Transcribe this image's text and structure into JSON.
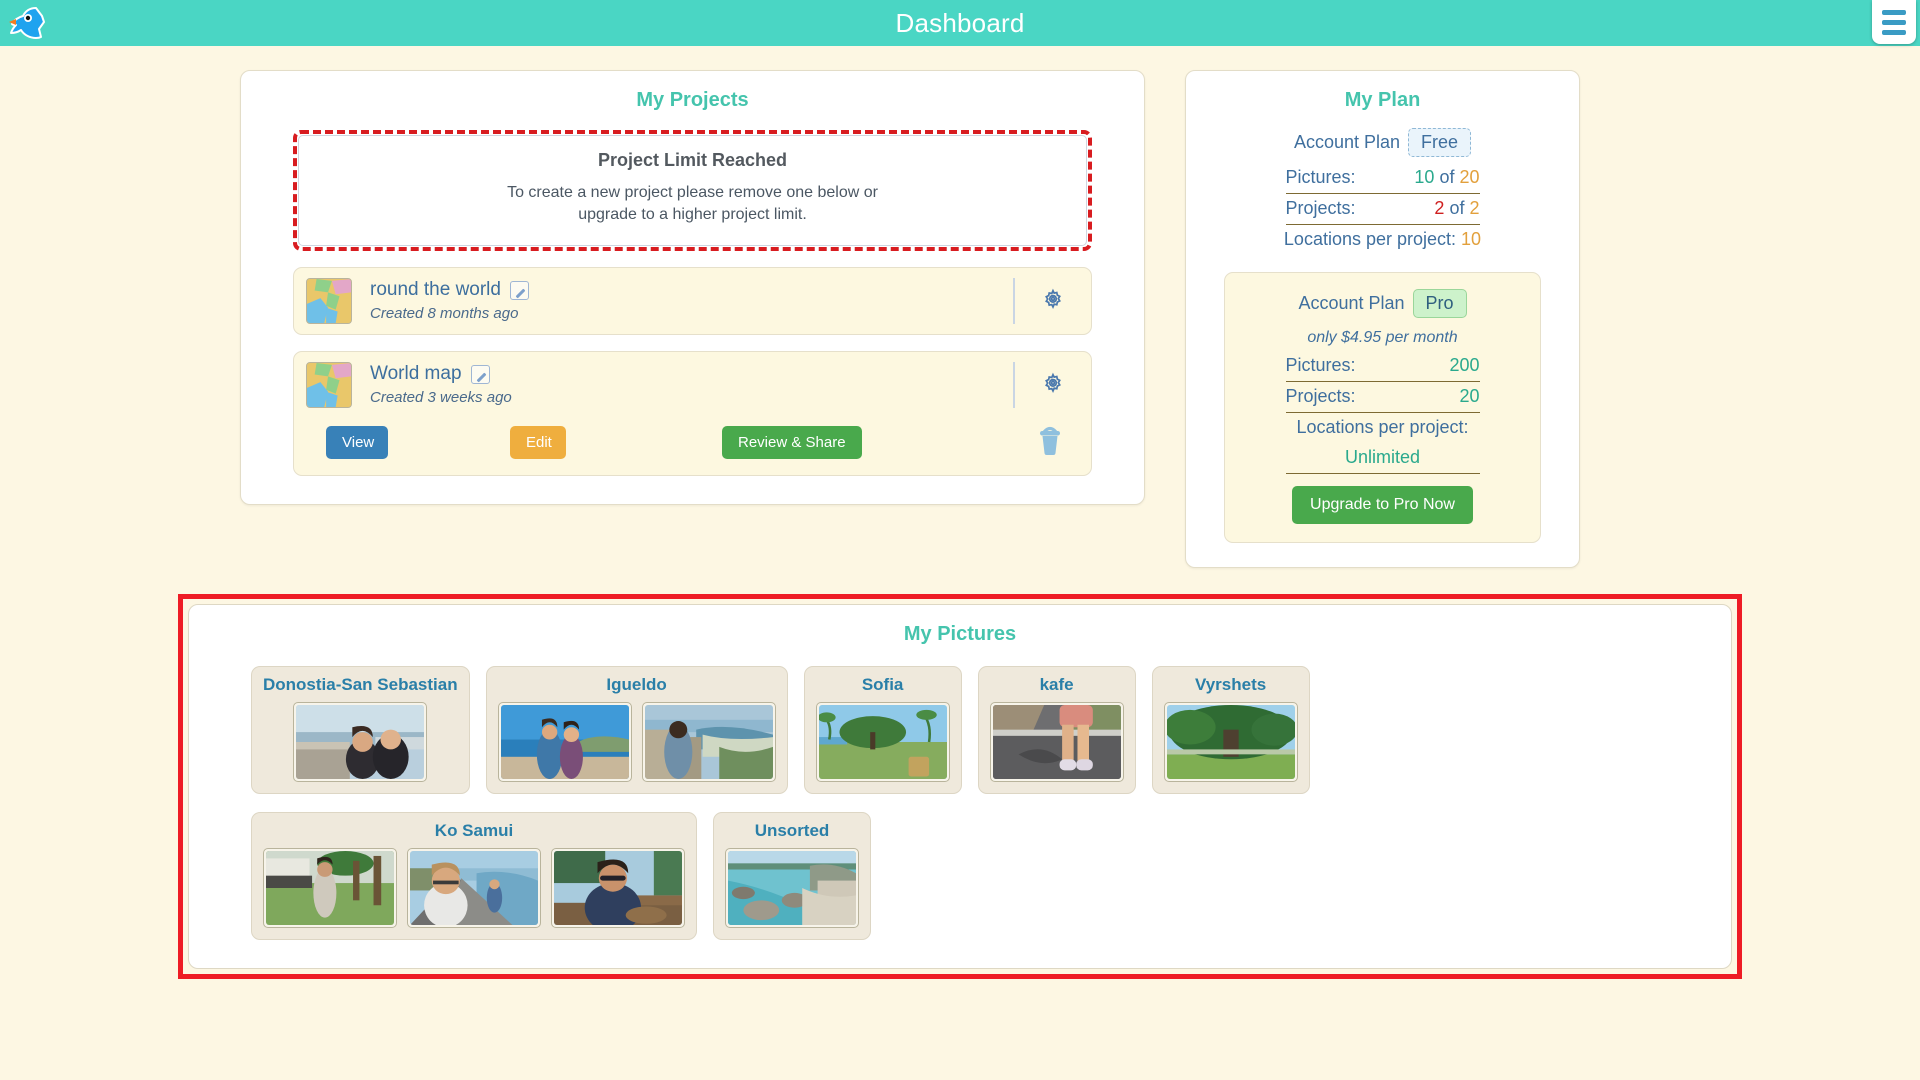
{
  "header": {
    "title": "Dashboard",
    "logo_icon": "bird-logo-icon",
    "menu_icon": "hamburger-menu-icon"
  },
  "projects_panel": {
    "title": "My Projects",
    "limit_alert": {
      "title": "Project Limit Reached",
      "line1": "To create a new project please remove one below or",
      "line2": "upgrade to a higher project limit."
    },
    "items": [
      {
        "name": "round the world",
        "created": "Created 8 months ago",
        "thumb_icon": "world-map-thumbnail",
        "edit_icon": "pencil-edit-icon",
        "gear_icon": "gear-settings-icon",
        "expanded": false
      },
      {
        "name": "World map",
        "created": "Created 3 weeks ago",
        "thumb_icon": "world-map-thumbnail",
        "edit_icon": "pencil-edit-icon",
        "gear_icon": "gear-settings-icon",
        "expanded": true
      }
    ],
    "actions": {
      "view": "View",
      "edit": "Edit",
      "share": "Review & Share",
      "delete_icon": "trash-delete-icon"
    }
  },
  "plan_panel": {
    "title": "My Plan",
    "free": {
      "account_plan_label": "Account Plan",
      "plan_chip": "Free",
      "pictures_label": "Pictures:",
      "pictures_used": "10",
      "pictures_of": "of",
      "pictures_total": "20",
      "projects_label": "Projects:",
      "projects_used": "2",
      "projects_of": "of",
      "projects_total": "2",
      "locations_label": "Locations per project:",
      "locations_value": "10"
    },
    "pro": {
      "account_plan_label": "Account Plan",
      "plan_chip": "Pro",
      "price": "only $4.95 per month",
      "pictures_label": "Pictures:",
      "pictures_value": "200",
      "projects_label": "Projects:",
      "projects_value": "20",
      "locations_label": "Locations per project:",
      "locations_value": "Unlimited",
      "upgrade_button": "Upgrade to Pro Now"
    }
  },
  "pictures_panel": {
    "title": "My Pictures",
    "groups_row1": [
      {
        "name": "Donostia-San Sebastian",
        "count": 1
      },
      {
        "name": "Igueldo",
        "count": 2
      },
      {
        "name": "Sofia",
        "count": 1
      },
      {
        "name": "kafe",
        "count": 1
      },
      {
        "name": "Vyrshets",
        "count": 1
      }
    ],
    "groups_row2": [
      {
        "name": "Ko Samui",
        "count": 3
      },
      {
        "name": "Unsorted",
        "count": 1
      }
    ]
  },
  "colors": {
    "header_teal": "#4ad6c4",
    "page_bg": "#fdf7e3",
    "accent_teal": "#45c4ad",
    "alert_red": "#d81c20",
    "highlight_red": "#ee1c25",
    "blue_link": "#3d6f9e",
    "green_button": "#49a94c",
    "orange_button": "#efae3e",
    "blue_button": "#3881b8",
    "picture_title_blue": "#2a7fa8"
  }
}
